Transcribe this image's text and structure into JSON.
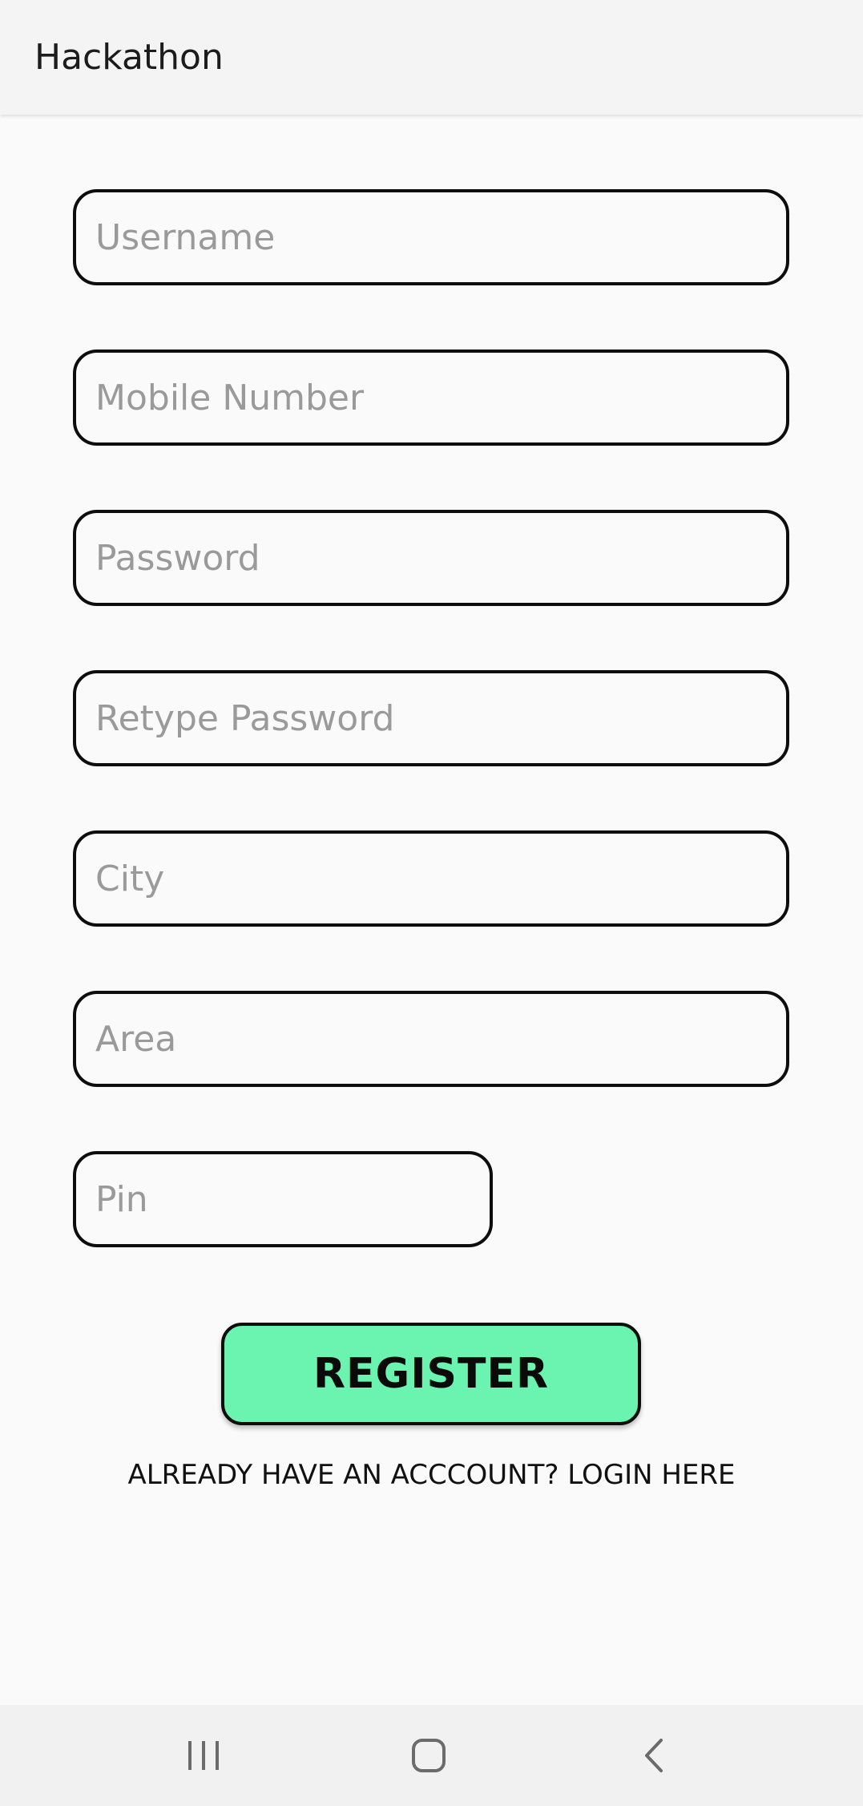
{
  "app_bar": {
    "title": "Hackathon"
  },
  "form": {
    "username_placeholder": "Username",
    "mobile_placeholder": "Mobile Number",
    "password_placeholder": "Password",
    "retype_password_placeholder": "Retype Password",
    "city_placeholder": "City",
    "area_placeholder": "Area",
    "pin_placeholder": "Pin"
  },
  "register_button": {
    "label": "REGISTER",
    "color": "#6af4b0"
  },
  "login_link": {
    "text": "ALREADY HAVE AN ACCCOUNT? LOGIN HERE"
  },
  "nav_bar": {
    "icons": [
      "recent-apps-icon",
      "home-icon",
      "back-icon"
    ]
  }
}
